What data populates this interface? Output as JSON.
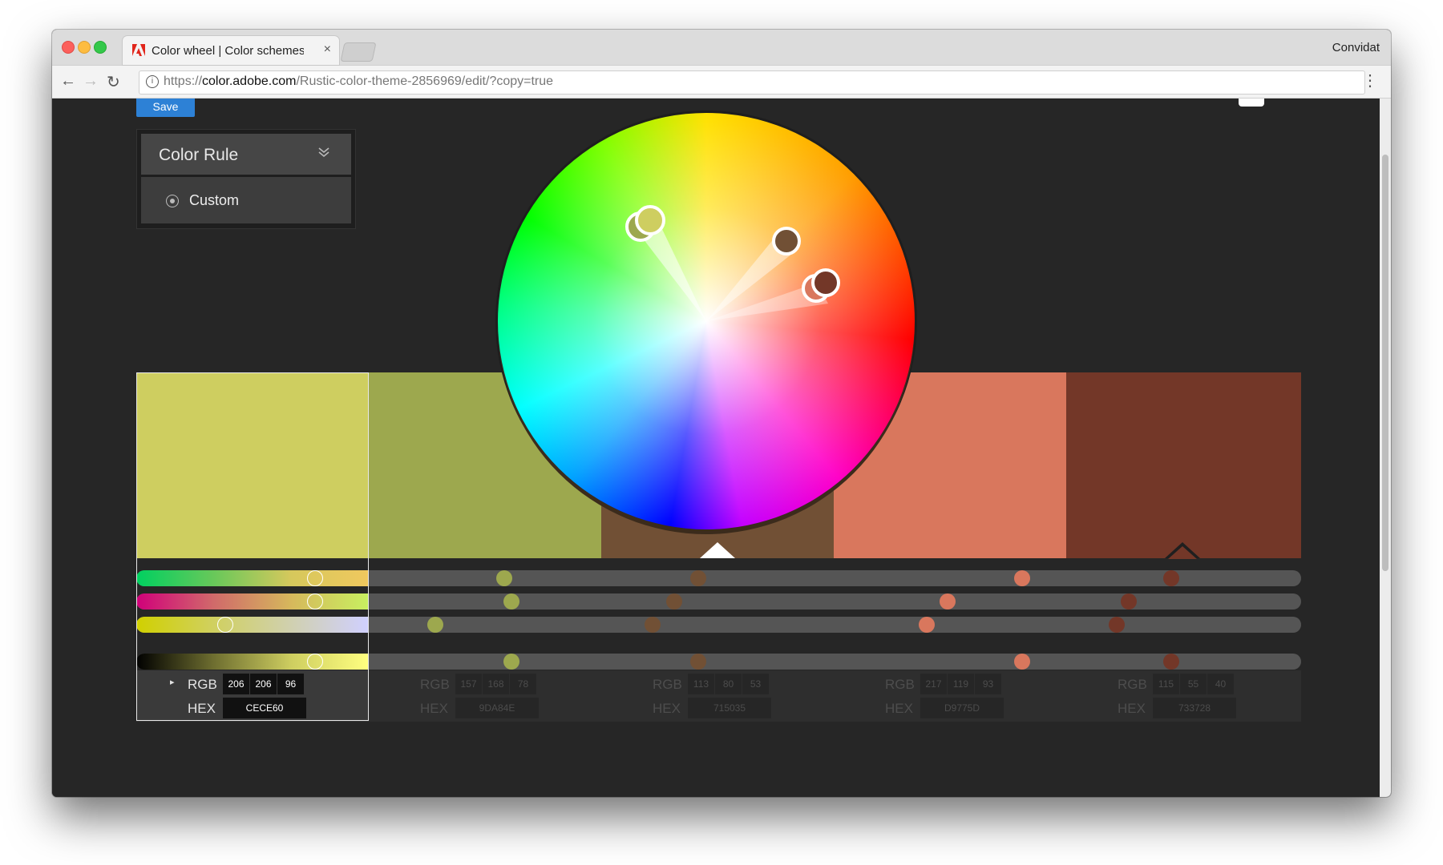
{
  "browser": {
    "tab_title": "Color wheel | Color schemes - Adobe Color CC",
    "close_glyph": "×",
    "user_name": "Convidat",
    "url_prefix": "https://",
    "url_domain": "color.adobe.com",
    "url_path": "/Rustic-color-theme-2856969/edit/?copy=true",
    "back_glyph": "←",
    "forward_glyph": "→",
    "reload_glyph": "↻",
    "menu_glyph": "⋮",
    "info_glyph": "i"
  },
  "toolbar": {
    "save_label": "Save"
  },
  "color_rule": {
    "title": "Color Rule",
    "selected": "Custom",
    "chevron": "⌄⌄"
  },
  "swatches": [
    {
      "hex": "CECE60",
      "color": "#CECE60",
      "rgb": [
        "206",
        "206",
        "96"
      ],
      "active": true
    },
    {
      "hex": "9DA84E",
      "color": "#9DA84E",
      "rgb": [
        "157",
        "168",
        "78"
      ],
      "active": false
    },
    {
      "hex": "715035",
      "color": "#715035",
      "rgb": [
        "113",
        "80",
        "53"
      ],
      "active": false
    },
    {
      "hex": "D9775D",
      "color": "#D9775D",
      "rgb": [
        "217",
        "119",
        "93"
      ],
      "active": false
    },
    {
      "hex": "733728",
      "color": "#733728",
      "rgb": [
        "115",
        "55",
        "40"
      ],
      "active": false
    }
  ],
  "labels": {
    "rgb": "RGB",
    "hex": "HEX",
    "expand_glyph": "▸"
  }
}
